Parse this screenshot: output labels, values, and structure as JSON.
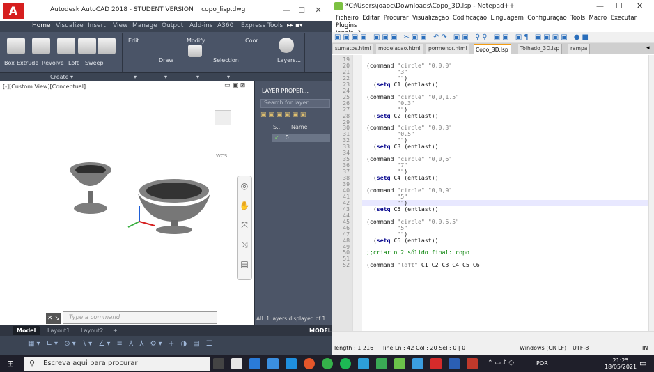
{
  "acad": {
    "title": "Autodesk AutoCAD 2018 - STUDENT VERSION",
    "file": "copo_lisp.dwg",
    "logo": "A",
    "tabs": [
      "Home",
      "Visualize",
      "Insert",
      "View",
      "Manage",
      "Output",
      "Add-ins",
      "A360",
      "Express Tools"
    ],
    "ribbon": {
      "create_tools": [
        "Box",
        "Extrude",
        "Revolve",
        "Loft",
        "Sweep"
      ],
      "edit": "Edit",
      "draw": "Draw",
      "modify": "Modify",
      "selection": "Selection",
      "coord": "Coor...",
      "layers": "Layers...",
      "create_panel": "Create"
    },
    "viewport_label": "[-][Custom View][Conceptual]",
    "wcs": "WCS",
    "layer_panel": {
      "title": "LAYER PROPER...",
      "search_placeholder": "Search for layer",
      "col_status": "S...",
      "col_name": "Name",
      "row_name": "0",
      "footer": "All: 1 layers displayed of 1"
    },
    "command_placeholder": "Type a command",
    "layout_tabs": [
      "Model",
      "Layout1",
      "Layout2",
      "+"
    ],
    "model_label": "MODEL"
  },
  "npp": {
    "title": "*C:\\Users\\joaoc\\Downloads\\Copo_3D.lsp - Notepad++",
    "menu": [
      "Ficheiro",
      "Editar",
      "Procurar",
      "Visualização",
      "Codificação",
      "Linguagem",
      "Configuração",
      "Tools",
      "Macro",
      "Executar",
      "Plugins",
      "Janela",
      "?"
    ],
    "tabs": [
      {
        "label": "sumatos.html",
        "active": false
      },
      {
        "label": "modelacao.html",
        "active": false
      },
      {
        "label": "pormenor.html",
        "active": false
      },
      {
        "label": "Copo_3D.lsp",
        "active": true
      },
      {
        "label": "Tolhado_3D.lsp",
        "active": false
      },
      {
        "label": "rampa",
        "active": false
      }
    ],
    "current_line": 42,
    "lines": [
      {
        "n": 19,
        "t": ""
      },
      {
        "n": 20,
        "t": "(command \"circle\" \"0,0,0\""
      },
      {
        "n": 21,
        "t": "         \"3\""
      },
      {
        "n": 22,
        "t": "         \"\")"
      },
      {
        "n": 23,
        "t": "  (setq C1 (entlast))"
      },
      {
        "n": 24,
        "t": ""
      },
      {
        "n": 25,
        "t": "(command \"circle\" \"0,0,1.5\""
      },
      {
        "n": 26,
        "t": "         \"0.3\""
      },
      {
        "n": 27,
        "t": "         \"\")"
      },
      {
        "n": 28,
        "t": "  (setq C2 (entlast))"
      },
      {
        "n": 29,
        "t": ""
      },
      {
        "n": 30,
        "t": "(command \"circle\" \"0,0,3\""
      },
      {
        "n": 31,
        "t": "         \"0.5\""
      },
      {
        "n": 32,
        "t": "         \"\")"
      },
      {
        "n": 33,
        "t": "  (setq C3 (entlast))"
      },
      {
        "n": 34,
        "t": ""
      },
      {
        "n": 35,
        "t": "(command \"circle\" \"0,0,6\""
      },
      {
        "n": 36,
        "t": "         \"7\""
      },
      {
        "n": 37,
        "t": "         \"\")"
      },
      {
        "n": 38,
        "t": "  (setq C4 (entlast))"
      },
      {
        "n": 39,
        "t": ""
      },
      {
        "n": 40,
        "t": "(command \"circle\" \"0,0,9\""
      },
      {
        "n": 41,
        "t": "         \"5\""
      },
      {
        "n": 42,
        "t": "         \"\")"
      },
      {
        "n": 43,
        "t": "  (setq C5 (entlast))"
      },
      {
        "n": 44,
        "t": ""
      },
      {
        "n": 45,
        "t": "(command \"circle\" \"0,0,6.5\""
      },
      {
        "n": 46,
        "t": "         \"5\""
      },
      {
        "n": 47,
        "t": "         \"\")"
      },
      {
        "n": 48,
        "t": "  (setq C6 (entlast))"
      },
      {
        "n": 49,
        "t": ""
      },
      {
        "n": 50,
        "t": ";;criar o 2 sólido final: copo"
      },
      {
        "n": 51,
        "t": ""
      },
      {
        "n": 52,
        "t": "(command \"loft\" C1 C2 C3 C4 C5 C6"
      }
    ],
    "status": {
      "length": "length : 1 216",
      "position": "line Ln : 42   Col : 20   Sel : 0 | 0",
      "eol": "Windows (CR LF)",
      "encoding": "UTF-8",
      "mode": "IN"
    }
  },
  "taskbar": {
    "search_placeholder": "Escreva aqui para procurar",
    "lang": "POR",
    "time": "21:25",
    "date": "18/05/2021"
  }
}
